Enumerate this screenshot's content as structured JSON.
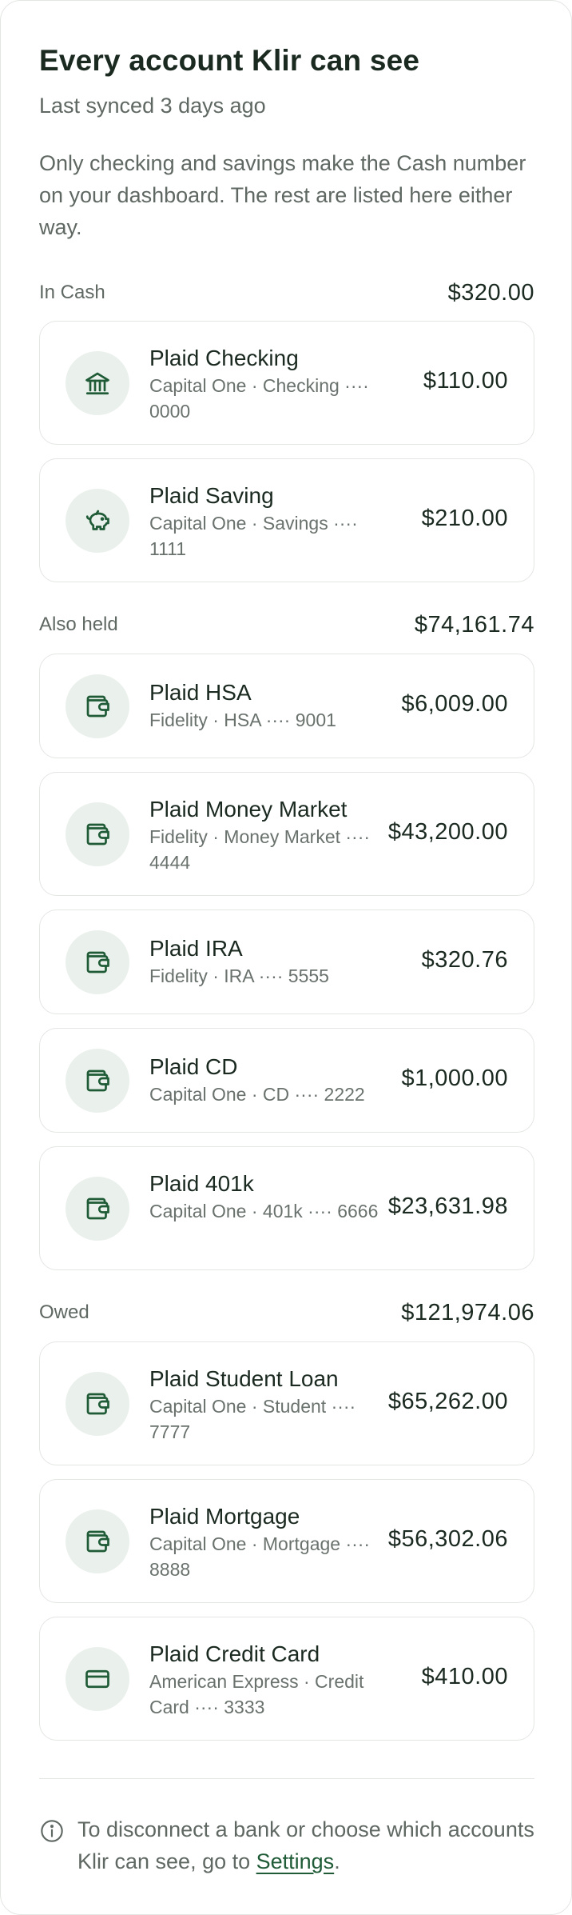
{
  "header": {
    "title": "Every account Klir can see",
    "subtitle": "Last synced 3 days ago",
    "intro": "Only checking and savings make the Cash number on your dashboard. The rest are listed here either way."
  },
  "sections": [
    {
      "label": "In Cash",
      "total": "$320.00",
      "accounts": [
        {
          "name": "Plaid Checking",
          "meta": "Capital One · Checking ···· 0000",
          "amount": "$110.00",
          "icon": "bank-icon"
        },
        {
          "name": "Plaid Saving",
          "meta": "Capital One · Savings ···· 1111",
          "amount": "$210.00",
          "icon": "piggy-bank-icon"
        }
      ]
    },
    {
      "label": "Also held",
      "total": "$74,161.74",
      "accounts": [
        {
          "name": "Plaid HSA",
          "meta": "Fidelity · HSA ···· 9001",
          "amount": "$6,009.00",
          "icon": "wallet-icon"
        },
        {
          "name": "Plaid Money Market",
          "meta": "Fidelity · Money Market ···· 4444",
          "amount": "$43,200.00",
          "icon": "wallet-icon"
        },
        {
          "name": "Plaid IRA",
          "meta": "Fidelity · IRA ···· 5555",
          "amount": "$320.76",
          "icon": "wallet-icon"
        },
        {
          "name": "Plaid CD",
          "meta": "Capital One · CD ···· 2222",
          "amount": "$1,000.00",
          "icon": "wallet-icon"
        },
        {
          "name": "Plaid 401k",
          "meta": "Capital One · 401k ···· 6666",
          "amount": "$23,631.98",
          "icon": "wallet-icon"
        }
      ]
    },
    {
      "label": "Owed",
      "total": "$121,974.06",
      "accounts": [
        {
          "name": "Plaid Student Loan",
          "meta": "Capital One · Student ···· 7777",
          "amount": "$65,262.00",
          "icon": "wallet-icon"
        },
        {
          "name": "Plaid Mortgage",
          "meta": "Capital One · Mortgage ···· 8888",
          "amount": "$56,302.06",
          "icon": "wallet-icon"
        },
        {
          "name": "Plaid Credit Card",
          "meta": "American Express · Credit Card ···· 3333",
          "amount": "$410.00",
          "icon": "credit-card-icon"
        }
      ]
    }
  ],
  "footer": {
    "text_before": "To disconnect a bank or choose which accounts Klir can see, go to ",
    "link": "Settings",
    "text_after": ".",
    "icon": "info-icon"
  },
  "colors": {
    "accent": "#1f5b36",
    "icon_bg": "#eaf0eb",
    "border": "#e3e6e3",
    "muted_text": "#5f6862"
  }
}
